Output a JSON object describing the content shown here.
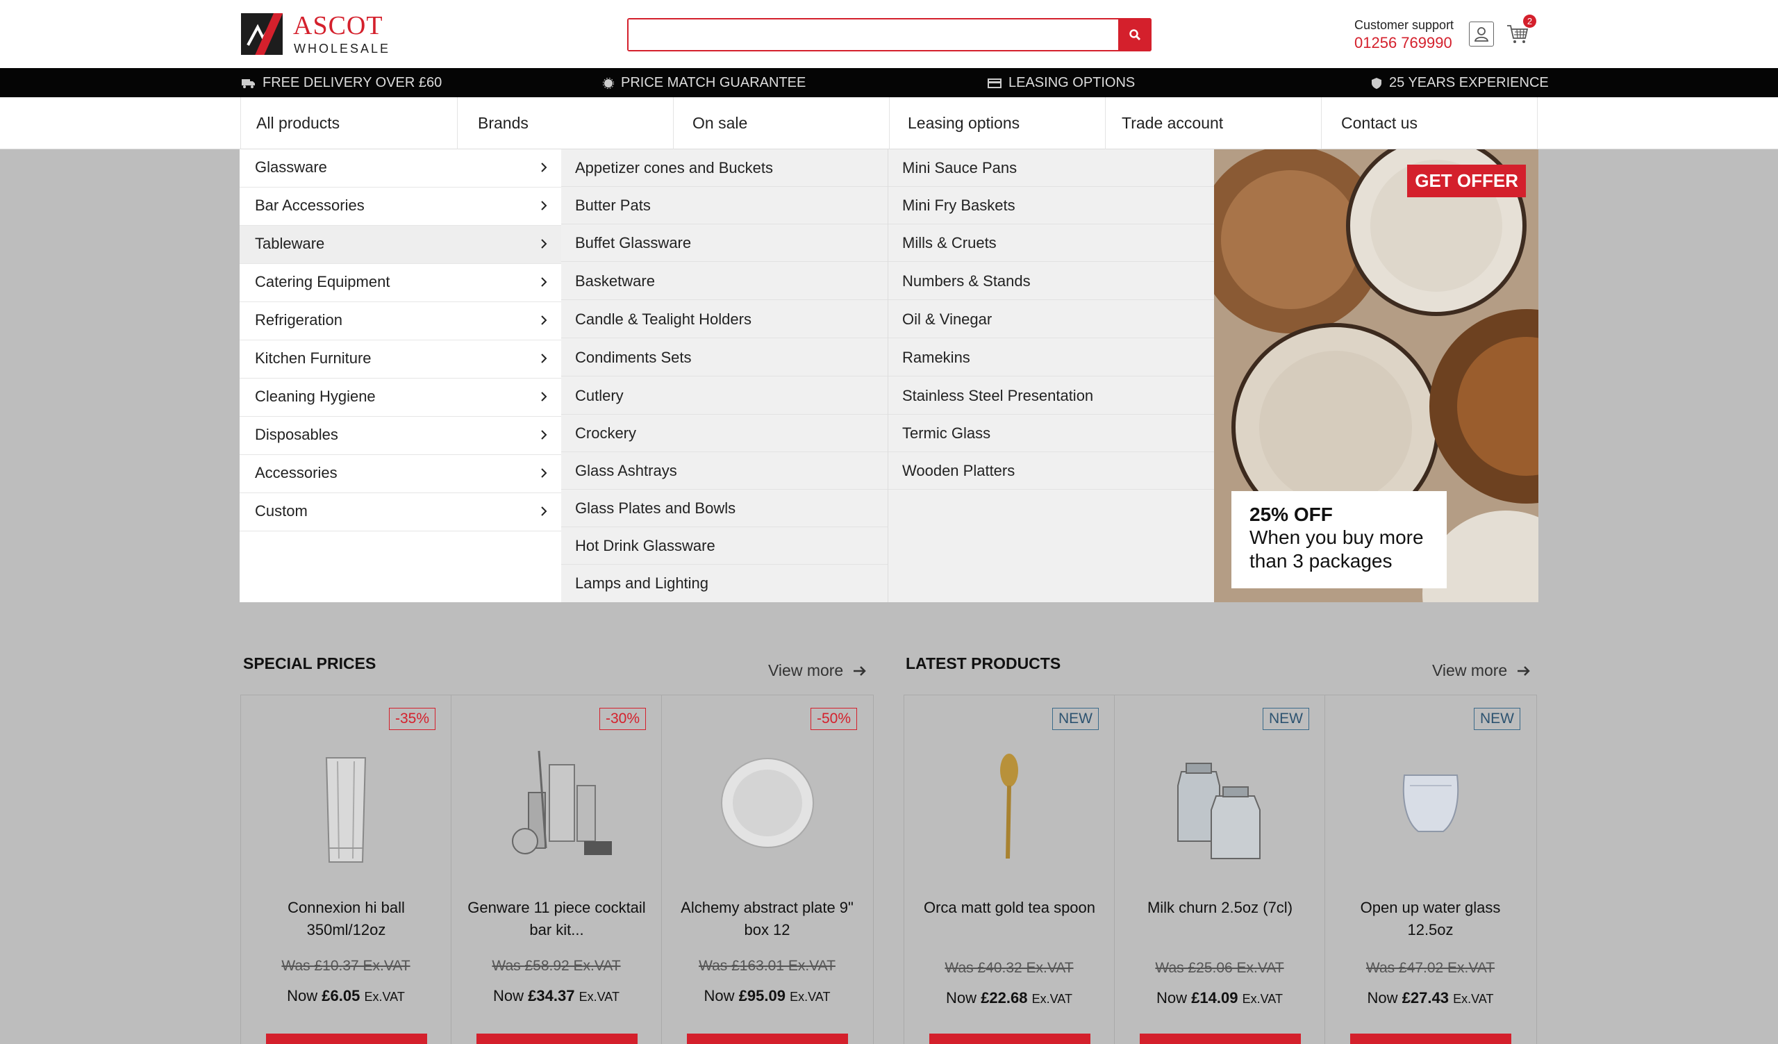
{
  "header": {
    "logo_line1": "ASCOT",
    "logo_line2": "WHOLESALE",
    "search_placeholder": "",
    "support_label": "Customer support",
    "support_phone": "01256 769990",
    "cart_count": "2"
  },
  "benefits": [
    {
      "icon": "truck-icon",
      "label": "FREE DELIVERY OVER £60"
    },
    {
      "icon": "badge-icon",
      "label": "PRICE MATCH GUARANTEE"
    },
    {
      "icon": "card-icon",
      "label": "LEASING OPTIONS"
    },
    {
      "icon": "shield-icon",
      "label": "25 YEARS EXPERIENCE"
    }
  ],
  "nav": [
    "All products",
    "Brands",
    "On sale",
    "Leasing options",
    "Trade account",
    "Contact us"
  ],
  "menu": {
    "categories": [
      "Glassware",
      "Bar Accessories",
      "Tableware",
      "Catering Equipment",
      "Refrigeration",
      "Kitchen Furniture",
      "Cleaning Hygiene",
      "Disposables",
      "Accessories",
      "Custom"
    ],
    "active_category": "Tableware",
    "sub_col1": [
      "Appetizer cones and Buckets",
      "Butter Pats",
      "Buffet Glassware",
      "Basketware",
      "Candle & Tealight Holders",
      "Condiments Sets",
      "Cutlery",
      "Crockery",
      "Glass Ashtrays",
      "Glass Plates and Bowls",
      "Hot Drink Glassware",
      "Lamps and Lighting"
    ],
    "sub_col2": [
      "Mini Sauce Pans",
      "Mini Fry Baskets",
      "Mills & Cruets",
      "Numbers & Stands",
      "Oil & Vinegar",
      "Ramekins",
      "Stainless Steel Presentation",
      "Termic Glass",
      "Wooden Platters"
    ],
    "promo": {
      "button": "GET OFFER",
      "title": "25% OFF",
      "text": "When you buy more than 3 packages"
    }
  },
  "special": {
    "title": "SPECIAL PRICES",
    "view_more": "View more",
    "products": [
      {
        "badge": "-35%",
        "name": "Connexion hi ball 350ml/12oz",
        "was": "Was £10.37 Ex.VAT",
        "now_label": "Now",
        "now_price": "£6.05",
        "vat": "Ex.VAT"
      },
      {
        "badge": "-30%",
        "name": "Genware 11 piece cocktail bar kit...",
        "was": "Was £58.92 Ex.VAT",
        "now_label": "Now",
        "now_price": "£34.37",
        "vat": "Ex.VAT"
      },
      {
        "badge": "-50%",
        "name": "Alchemy abstract plate 9\" box 12",
        "was": "Was £163.01 Ex.VAT",
        "now_label": "Now",
        "now_price": "£95.09",
        "vat": "Ex.VAT"
      }
    ]
  },
  "latest": {
    "title": "LATEST PRODUCTS",
    "view_more": "View more",
    "products": [
      {
        "badge": "NEW",
        "name": "Orca matt gold tea spoon",
        "was": "Was £40.32 Ex.VAT",
        "now_label": "Now",
        "now_price": "£22.68",
        "vat": "Ex.VAT"
      },
      {
        "badge": "NEW",
        "name": "Milk churn 2.5oz (7cl)",
        "was": "Was £25.06 Ex.VAT",
        "now_label": "Now",
        "now_price": "£14.09",
        "vat": "Ex.VAT"
      },
      {
        "badge": "NEW",
        "name": "Open up water glass 12.5oz",
        "was": "Was £47.02 Ex.VAT",
        "now_label": "Now",
        "now_price": "£27.43",
        "vat": "Ex.VAT"
      }
    ]
  },
  "colors": {
    "brand_red": "#d4202c",
    "new_blue": "#2d5370"
  }
}
